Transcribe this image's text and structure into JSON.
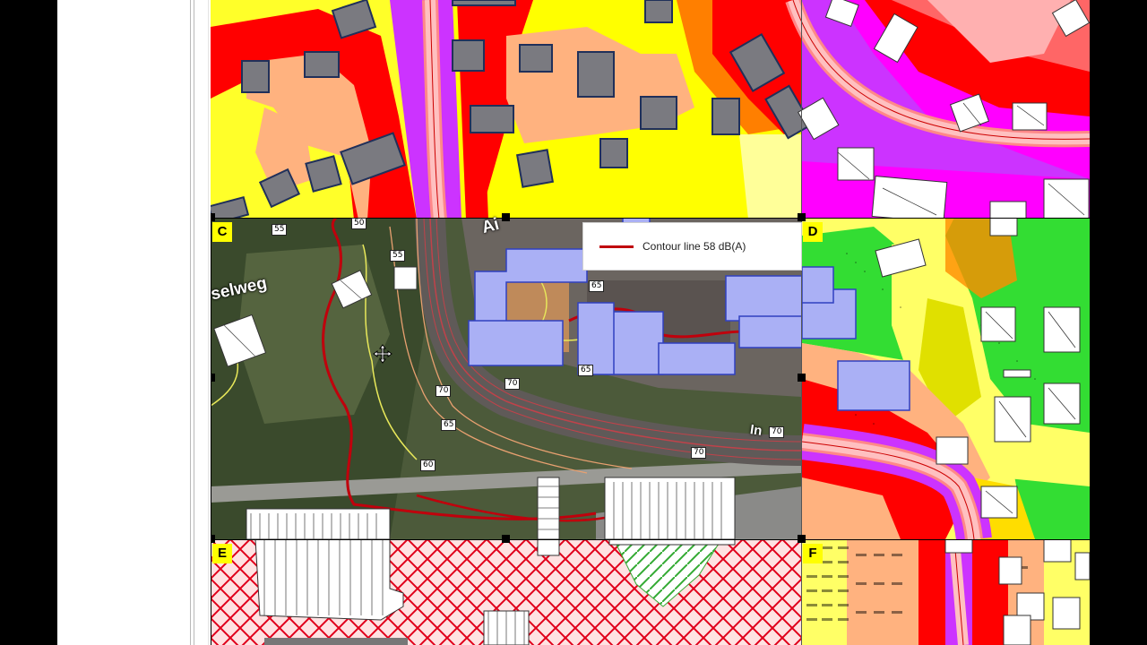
{
  "panels": {
    "c": {
      "letter": "C"
    },
    "d": {
      "letter": "D"
    },
    "e": {
      "letter": "E"
    },
    "f": {
      "letter": "F"
    }
  },
  "legend": {
    "items": [
      {
        "label": "Contour line 58 dB(A)",
        "color": "#c0000c"
      }
    ]
  },
  "contour_labels": [
    "50",
    "55",
    "55",
    "65",
    "70",
    "65",
    "70",
    "70",
    "70",
    "65",
    "60"
  ],
  "street_labels": [
    "selweg",
    "Ai",
    "In"
  ],
  "colors": {
    "noise_red": "#ff0000",
    "noise_purple": "#cc33ff",
    "noise_magenta": "#ff00ff",
    "noise_orange": "#ffb27f",
    "noise_yellow": "#ffff00",
    "noise_green": "#33dd33",
    "building_grey": "#7a7a80",
    "building_blue": "#aab0f5",
    "panel_letter_bg": "#ffff00"
  },
  "icons": [
    "move-cursor-icon",
    "resize-handle-icon"
  ]
}
